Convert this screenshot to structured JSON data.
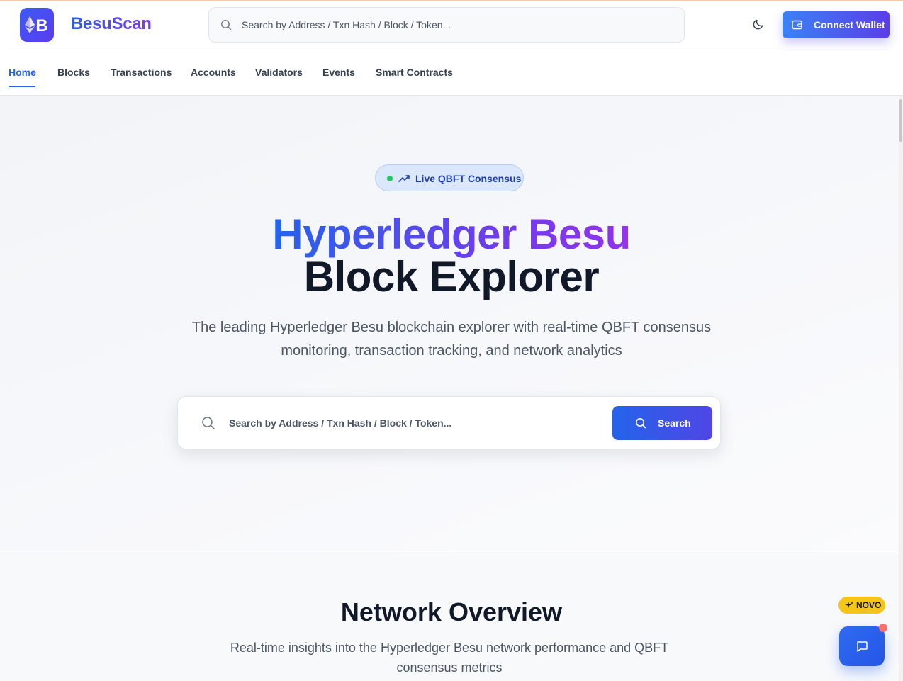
{
  "app": {
    "brand": "BesuScan",
    "logo_letter": "B"
  },
  "header": {
    "search_placeholder": "Search by Address / Txn Hash / Block / Token...",
    "connect_wallet_label": "Connect Wallet"
  },
  "nav": {
    "items": [
      {
        "label": "Home",
        "active": true
      },
      {
        "label": "Blocks"
      },
      {
        "label": "Transactions"
      },
      {
        "label": "Accounts"
      },
      {
        "label": "Validators"
      },
      {
        "label": "Events"
      },
      {
        "label": "Smart Contracts"
      }
    ]
  },
  "hero": {
    "badge": "Live QBFT Consensus",
    "title_line1": "Hyperledger Besu",
    "title_line2": "Block Explorer",
    "subtitle": "The leading Hyperledger Besu blockchain explorer with real-time QBFT consensus monitoring, transaction tracking, and network analytics",
    "search_placeholder": "Search by Address / Txn Hash / Block / Token...",
    "search_button": "Search"
  },
  "overview": {
    "title": "Network Overview",
    "subtitle": "Real-time insights into the Hyperledger Besu network performance and QBFT consensus metrics"
  },
  "widgets": {
    "novo_badge": "NOVO"
  },
  "colors": {
    "brand_blue": "#2563eb",
    "brand_purple": "#7e3af2",
    "live_dot": "#22c55e",
    "novo_yellow": "#f5c518"
  }
}
